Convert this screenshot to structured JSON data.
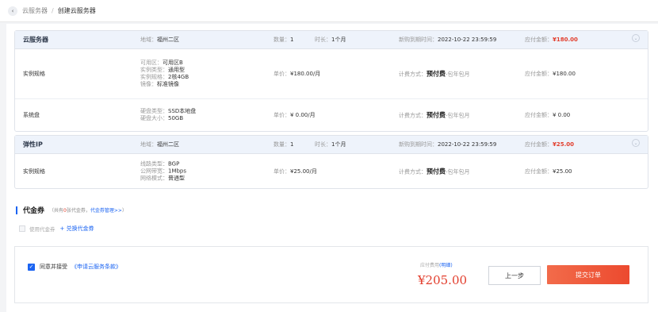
{
  "breadcrumb": {
    "back_icon": "chevron-left-icon",
    "parent": "云服务器",
    "separator": "/",
    "current": "创建云服务器"
  },
  "server_card": {
    "title": "云服务器",
    "region_label": "地域：",
    "region": "福州二区",
    "qty_label": "数量：",
    "qty": "1",
    "duration_label": "时长：",
    "duration": "1个月",
    "expire_label": "新购到期时间：",
    "expire": "2022-10-22 23:59:59",
    "amount_label": "应付金额：",
    "amount": "¥180.00",
    "rows": [
      {
        "name": "实例规格",
        "specs": [
          {
            "label": "可用区：",
            "value": "可用区B"
          },
          {
            "label": "实例类型：",
            "value": "通用型"
          },
          {
            "label": "实例规格：",
            "value": "2核4GB"
          },
          {
            "label": "镜像：",
            "value": "标准镜像"
          }
        ],
        "price_label": "单价：",
        "price": "¥180.00/月",
        "billing_label": "计费方式：",
        "billing": "预付费",
        "billing_sub": "-包年包月",
        "amount_label": "应付金额：",
        "amount": "¥180.00"
      },
      {
        "name": "系统盘",
        "specs": [
          {
            "label": "硬盘类型：",
            "value": "SSD本地盘"
          },
          {
            "label": "硬盘大小：",
            "value": "50GB"
          }
        ],
        "price_label": "单价：",
        "price": "¥ 0.00/月",
        "billing_label": "计费方式：",
        "billing": "预付费",
        "billing_sub": "-包年包月",
        "amount_label": "应付金额：",
        "amount": "¥ 0.00"
      }
    ]
  },
  "eip_card": {
    "title": "弹性IP",
    "region_label": "地域：",
    "region": "福州二区",
    "qty_label": "数量：",
    "qty": "1",
    "duration_label": "时长：",
    "duration": "1个月",
    "expire_label": "新购到期时间：",
    "expire": "2022-10-22 23:59:59",
    "amount_label": "应付金额：",
    "amount": "¥25.00",
    "rows": [
      {
        "name": "实例规格",
        "specs": [
          {
            "label": "线路类型：",
            "value": "BGP"
          },
          {
            "label": "公网带宽：",
            "value": "1Mbps"
          },
          {
            "label": "网络模式：",
            "value": "普通型"
          }
        ],
        "price_label": "单价：",
        "price": "¥25.00/月",
        "billing_label": "计费方式：",
        "billing": "预付费",
        "billing_sub": "-包年包月",
        "amount_label": "应付金额：",
        "amount": "¥25.00"
      }
    ]
  },
  "voucher": {
    "title": "代金券",
    "note_prefix": "（共有",
    "note_count": "0",
    "note_mid": "张代金券，",
    "note_link": "代金券管理>>",
    "note_suffix": "）",
    "use_label": "使用代金券",
    "exchange": "+ 兑换代金券"
  },
  "footer": {
    "agree_text": "同意并接受",
    "agree_link": "《申请云服务条款》",
    "pay_label": "应付费用",
    "pay_detail": "(明细)",
    "total": "¥205.00",
    "prev": "上一步",
    "submit": "提交订单"
  },
  "colors": {
    "accent": "#1b64f2",
    "price_red": "#e23d2c",
    "submit_start": "#f26b4a",
    "submit_end": "#ec4a2f"
  }
}
